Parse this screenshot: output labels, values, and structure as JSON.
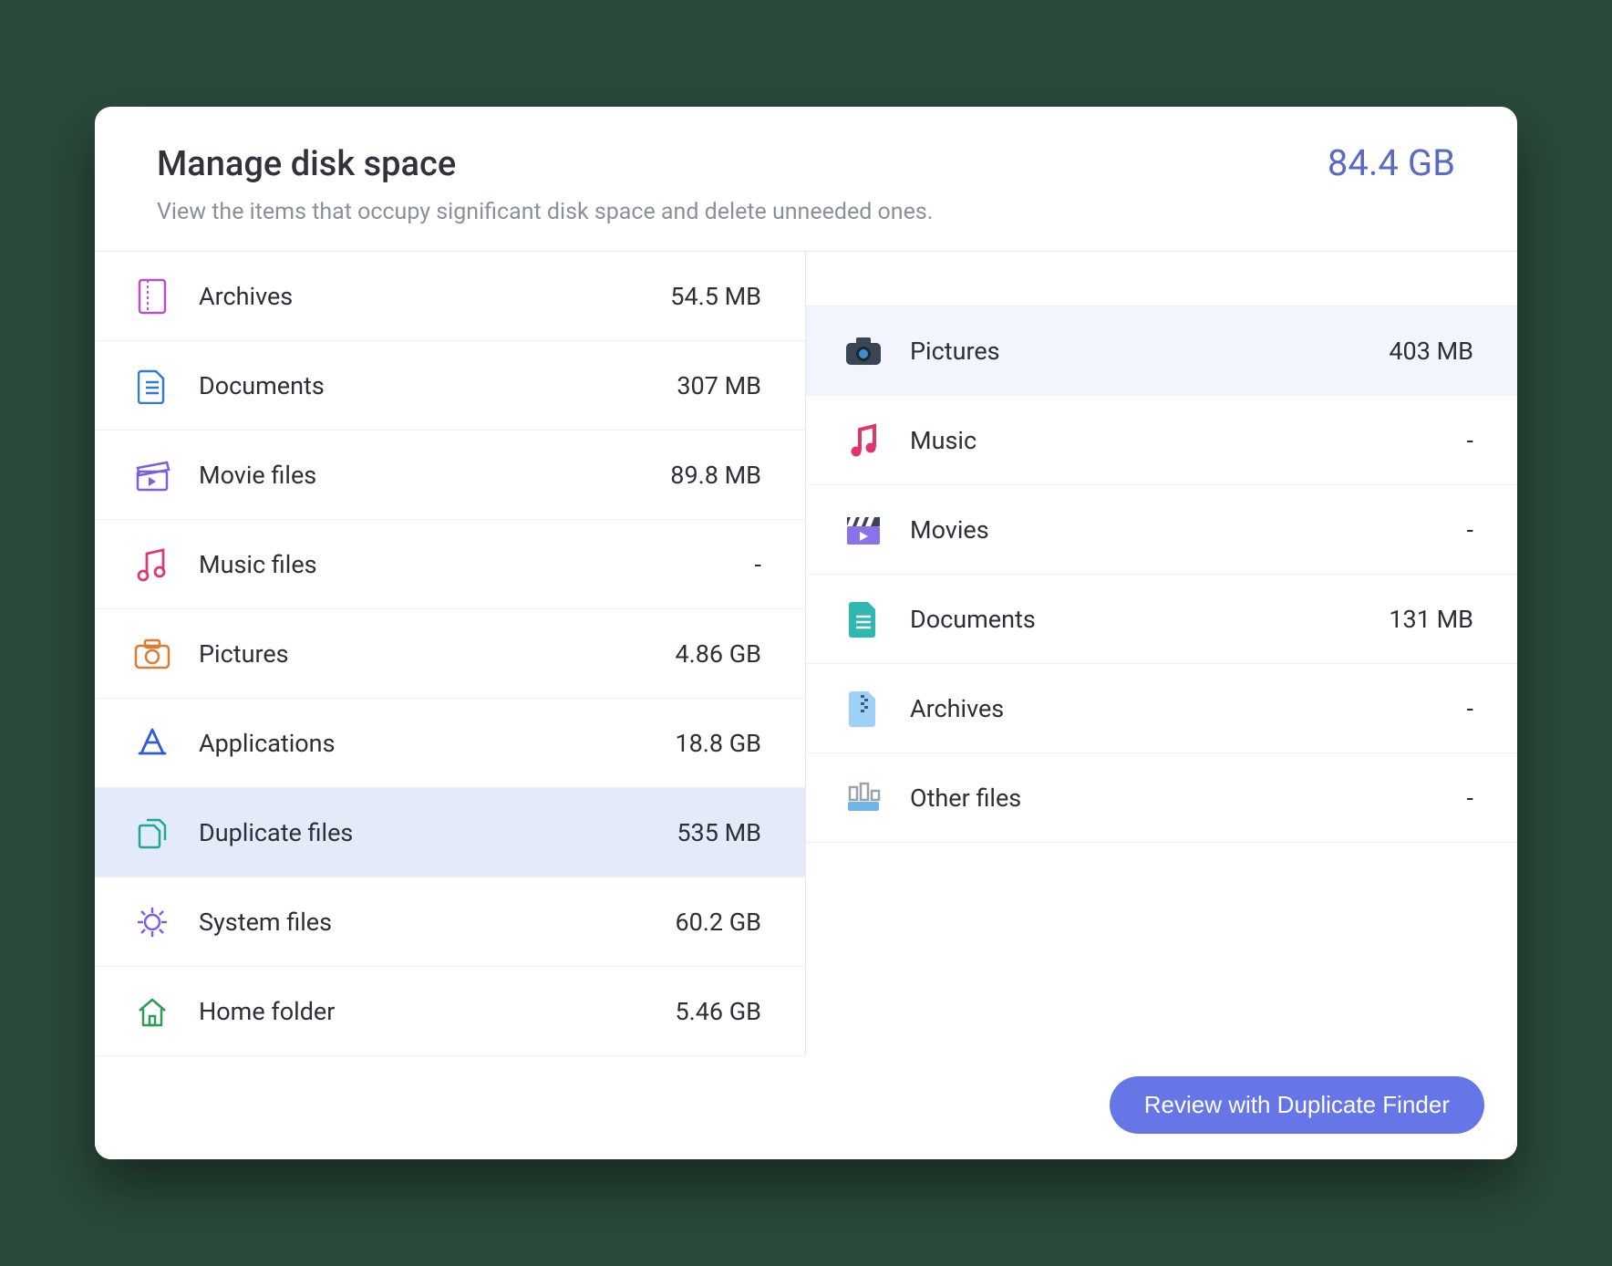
{
  "header": {
    "title": "Manage disk space",
    "subtitle": "View the items that occupy significant disk space and delete unneeded ones.",
    "total": "84.4 GB"
  },
  "left": [
    {
      "icon": "archive-icon",
      "label": "Archives",
      "size": "54.5 MB",
      "selected": false
    },
    {
      "icon": "document-icon",
      "label": "Documents",
      "size": "307 MB",
      "selected": false
    },
    {
      "icon": "movie-icon",
      "label": "Movie files",
      "size": "89.8 MB",
      "selected": false
    },
    {
      "icon": "music-icon",
      "label": "Music files",
      "size": "-",
      "selected": false
    },
    {
      "icon": "picture-icon",
      "label": "Pictures",
      "size": "4.86 GB",
      "selected": false
    },
    {
      "icon": "app-icon",
      "label": "Applications",
      "size": "18.8 GB",
      "selected": false
    },
    {
      "icon": "duplicate-icon",
      "label": "Duplicate files",
      "size": "535 MB",
      "selected": true
    },
    {
      "icon": "system-icon",
      "label": "System files",
      "size": "60.2 GB",
      "selected": false
    },
    {
      "icon": "home-icon",
      "label": "Home folder",
      "size": "5.46 GB",
      "selected": false
    }
  ],
  "right": [
    {
      "icon": "camera-icon",
      "label": "Pictures",
      "size": "403 MB",
      "selected": true
    },
    {
      "icon": "music-note-icon",
      "label": "Music",
      "size": "-",
      "selected": false
    },
    {
      "icon": "clapper-icon",
      "label": "Movies",
      "size": "-",
      "selected": false
    },
    {
      "icon": "doc-solid-icon",
      "label": "Documents",
      "size": "131 MB",
      "selected": false
    },
    {
      "icon": "zip-icon",
      "label": "Archives",
      "size": "-",
      "selected": false
    },
    {
      "icon": "other-icon",
      "label": "Other files",
      "size": "-",
      "selected": false
    }
  ],
  "footer": {
    "review_label": "Review with Duplicate Finder"
  }
}
